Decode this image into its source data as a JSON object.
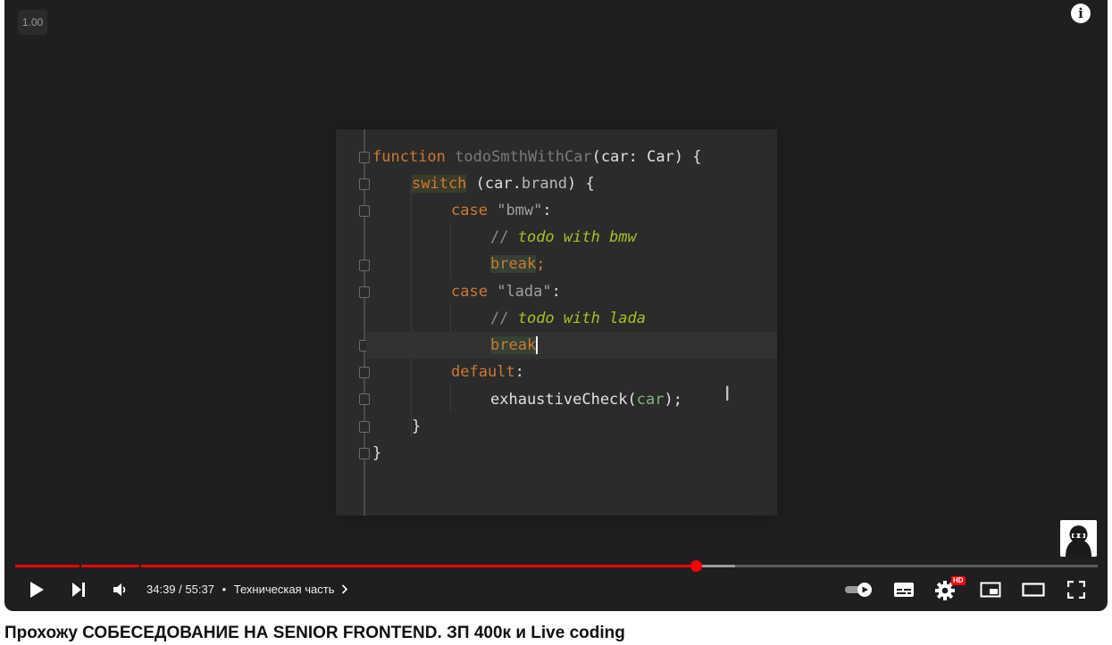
{
  "player": {
    "playback_speed": "1.00",
    "info_icon": "info-icon",
    "progress": {
      "played_fraction": 0.6287,
      "buffered_fraction": 0.665
    },
    "controls": {
      "current_time": "34:39",
      "duration": "55:37",
      "separator": "/",
      "chapter": "Техническая часть",
      "icons": [
        "play-icon",
        "next-icon",
        "volume-icon",
        "autoplay-toggle-icon",
        "subtitles-icon",
        "settings-icon",
        "miniplayer-icon",
        "theater-mode-icon",
        "fullscreen-icon"
      ],
      "settings_badge": "HD"
    },
    "colors": {
      "accent": "#ff0000",
      "player_bg": "#1f1f22",
      "control_fg": "#ffffff"
    }
  },
  "code": {
    "lines": [
      {
        "text": "function todoSmthWithCar(car: Car) {"
      },
      {
        "text": "switch (car.brand) {"
      },
      {
        "text": "case \"bmw\":"
      },
      {
        "text": "// todo with bmw"
      },
      {
        "text": "break;"
      },
      {
        "text": "case \"lada\":"
      },
      {
        "text": "// todo with lada"
      },
      {
        "text": "break"
      },
      {
        "text": "default:"
      },
      {
        "text": "exhaustiveCheck(car);"
      },
      {
        "text": "}"
      },
      {
        "text": "}"
      }
    ]
  },
  "video_title": "Прохожу СОБЕСЕДОВАНИЕ НА SENIOR FRONTEND. ЗП 400к и Live coding"
}
